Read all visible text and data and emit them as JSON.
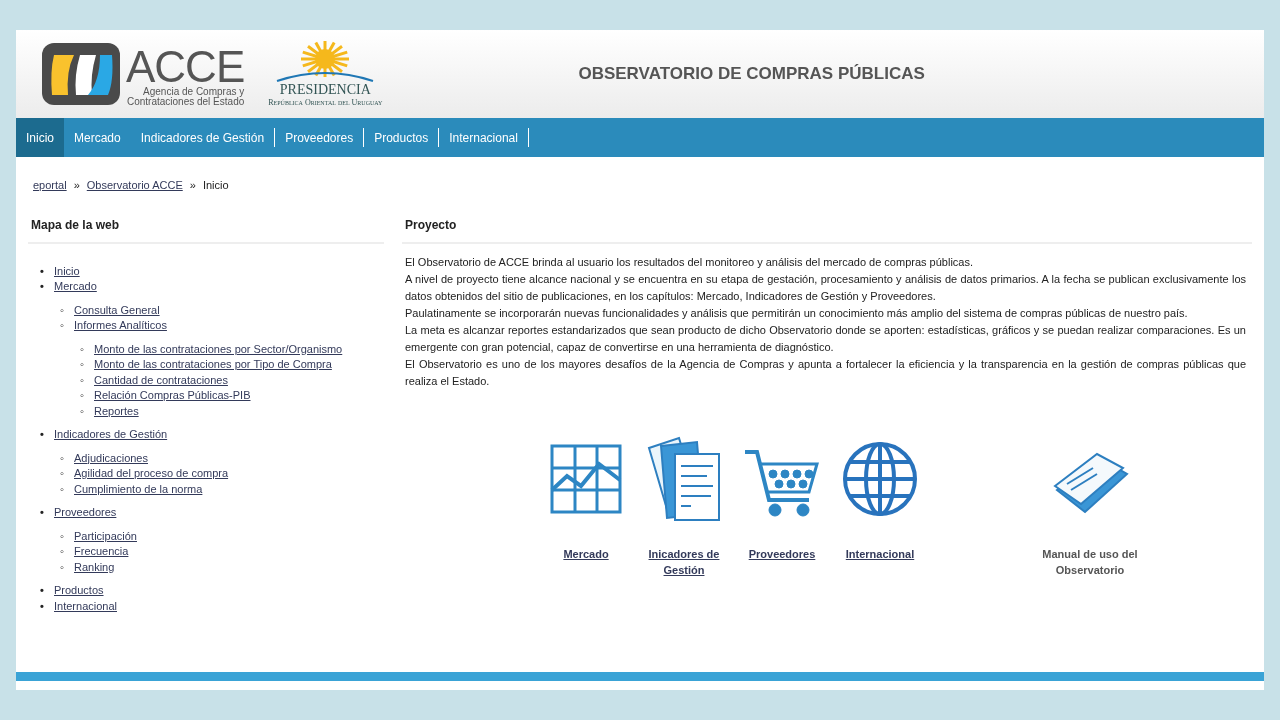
{
  "header": {
    "logo_text": "ACCE",
    "logo_subtitle": [
      "Agencia de Compras y",
      "Contrataciones del Estado"
    ],
    "presidencia": "PRESIDENCIA",
    "presidencia_subtitle": "República Oriental del Uruguay",
    "title": "OBSERVATORIO DE COMPRAS PÚBLICAS"
  },
  "nav": [
    {
      "label": "Inicio",
      "selected": true,
      "separator": false
    },
    {
      "label": "Mercado",
      "selected": false,
      "separator": false
    },
    {
      "label": "Indicadores de Gestión",
      "selected": false,
      "separator": true
    },
    {
      "label": "Proveedores",
      "selected": false,
      "separator": true
    },
    {
      "label": "Productos",
      "selected": false,
      "separator": true
    },
    {
      "label": "Internacional",
      "selected": false,
      "separator": true
    }
  ],
  "breadcrumb": [
    {
      "label": "eportal",
      "link": true
    },
    {
      "label": "Observatorio ACCE",
      "link": true
    },
    {
      "label": "Inicio",
      "link": false
    }
  ],
  "breadcrumb_separator": "»",
  "sitemap": {
    "title": "Mapa de la web",
    "items": [
      {
        "marker": "•",
        "label": "Inicio"
      },
      {
        "marker": "•",
        "label": "Mercado",
        "children": [
          {
            "marker": "◦",
            "label": "Consulta General"
          },
          {
            "marker": "◦",
            "label": "Informes Analíticos",
            "children": [
              {
                "marker": "◦",
                "label": "Monto de las contrataciones por Sector/Organismo"
              },
              {
                "marker": "◦",
                "label": "Monto de las contrataciones por Tipo de Compra"
              },
              {
                "marker": "◦",
                "label": "Cantidad de contrataciones"
              },
              {
                "marker": "◦",
                "label": "Relación Compras Públicas-PIB"
              },
              {
                "marker": "◦",
                "label": "Reportes"
              }
            ]
          }
        ]
      },
      {
        "marker": "•",
        "label": "Indicadores de Gestión",
        "children": [
          {
            "marker": "◦",
            "label": "Adjudicaciones"
          },
          {
            "marker": "◦",
            "label": "Agilidad del proceso de compra"
          },
          {
            "marker": "◦",
            "label": "Cumplimiento de la norma"
          }
        ]
      },
      {
        "marker": "•",
        "label": "Proveedores",
        "children": [
          {
            "marker": "◦",
            "label": "Participación"
          },
          {
            "marker": "◦",
            "label": "Frecuencia"
          },
          {
            "marker": "◦",
            "label": "Ranking"
          }
        ]
      },
      {
        "marker": "•",
        "label": "Productos"
      },
      {
        "marker": "•",
        "label": "Internacional"
      }
    ]
  },
  "project": {
    "title": "Proyecto",
    "paragraphs": [
      "El Observatorio de ACCE brinda al usuario los resultados del monitoreo y análisis del mercado de compras públicas.",
      "A nivel de proyecto tiene alcance nacional y se encuentra en su etapa de gestación, procesamiento y análisis de datos primarios. A la fecha se publican exclusivamente los datos obtenidos del sitio de publicaciones, en los capítulos: Mercado, Indicadores de Gestión y Proveedores.",
      "Paulatinamente se incorporarán nuevas funcionalidades y análisis que permitirán un conocimiento más amplio del sistema de compras públicas de nuestro país.",
      "La meta es alcanzar reportes estandarizados que sean producto de dicho Observatorio donde se aporten: estadísticas, gráficos y se puedan realizar comparaciones. Es un emergente con gran potencial, capaz de convertirse en una herramienta de diagnóstico.",
      "El Observatorio es uno de los mayores desafíos de la Agencia de Compras y apunta a fortalecer la eficiencia y la transparencia en la gestión de compras públicas que realiza el Estado."
    ]
  },
  "tiles": [
    {
      "kind": "chart",
      "label": "Mercado",
      "link": true
    },
    {
      "kind": "documents",
      "label": "Inicadores de Gestión",
      "link": true
    },
    {
      "kind": "cart",
      "label": "Proveedores",
      "link": true
    },
    {
      "kind": "globe",
      "label": "Internacional",
      "link": true
    },
    {
      "kind": "manual",
      "label": "Manual de uso del Observatorio",
      "link": false
    }
  ]
}
